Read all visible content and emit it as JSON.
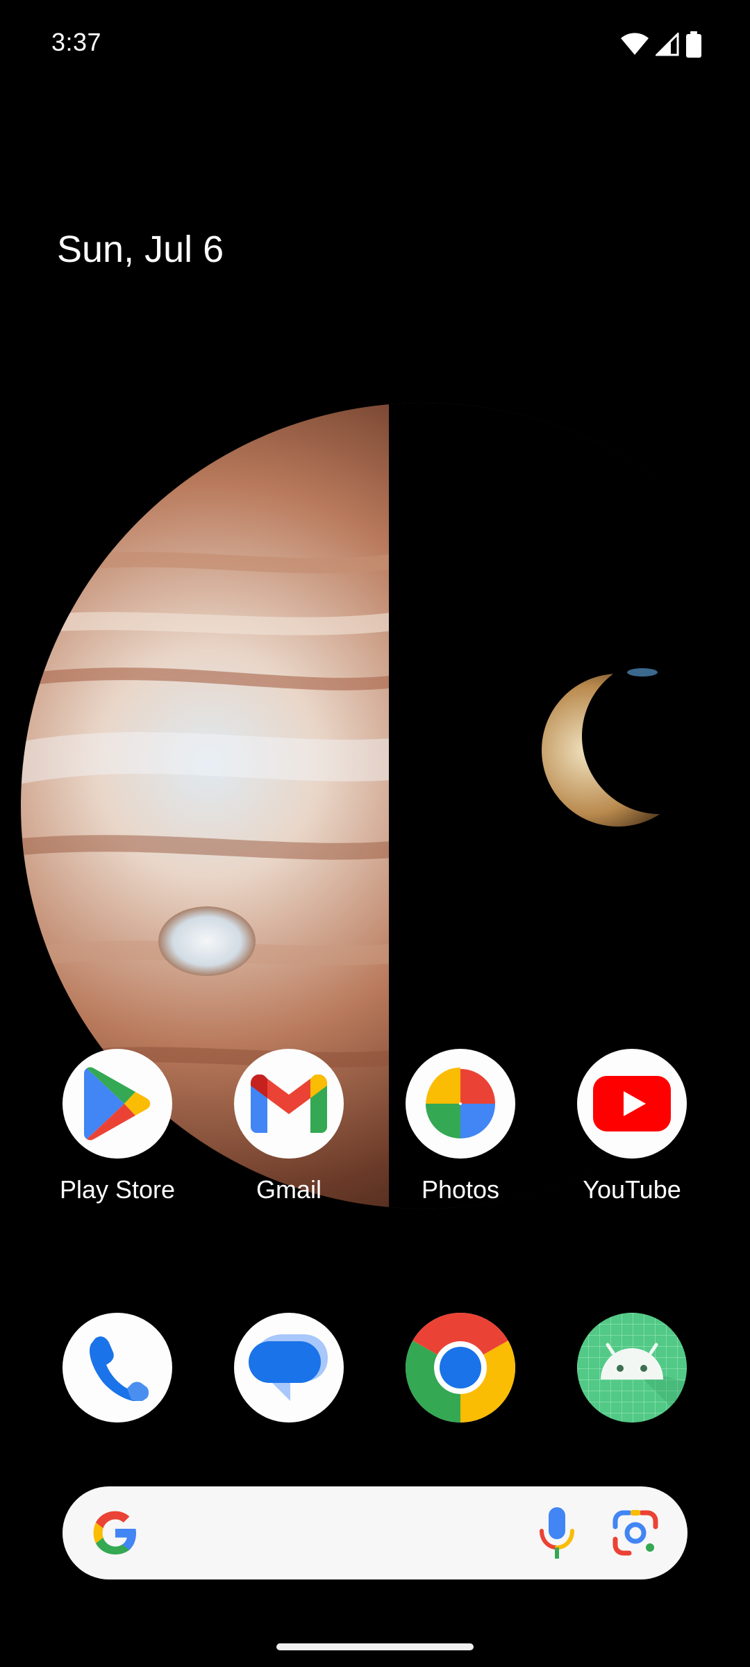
{
  "status_bar": {
    "time": "3:37",
    "icons": [
      "wifi-icon",
      "cellular-signal-icon",
      "battery-icon"
    ]
  },
  "home": {
    "date": "Sun, Jul 6"
  },
  "apps": [
    {
      "label": "Play Store",
      "icon": "play-store-icon"
    },
    {
      "label": "Gmail",
      "icon": "gmail-icon"
    },
    {
      "label": "Photos",
      "icon": "photos-icon"
    },
    {
      "label": "YouTube",
      "icon": "youtube-icon"
    }
  ],
  "dock": [
    {
      "icon": "phone-icon"
    },
    {
      "icon": "messages-icon"
    },
    {
      "icon": "chrome-icon"
    },
    {
      "icon": "android-icon"
    }
  ],
  "search": {
    "icons": [
      "google-logo-icon",
      "microphone-icon",
      "lens-icon"
    ]
  },
  "colors": {
    "background": "#000000",
    "google_blue": "#4285F4",
    "google_red": "#EA4335",
    "google_yellow": "#FBBC04",
    "google_green": "#34A853",
    "youtube_red": "#FF0000"
  }
}
